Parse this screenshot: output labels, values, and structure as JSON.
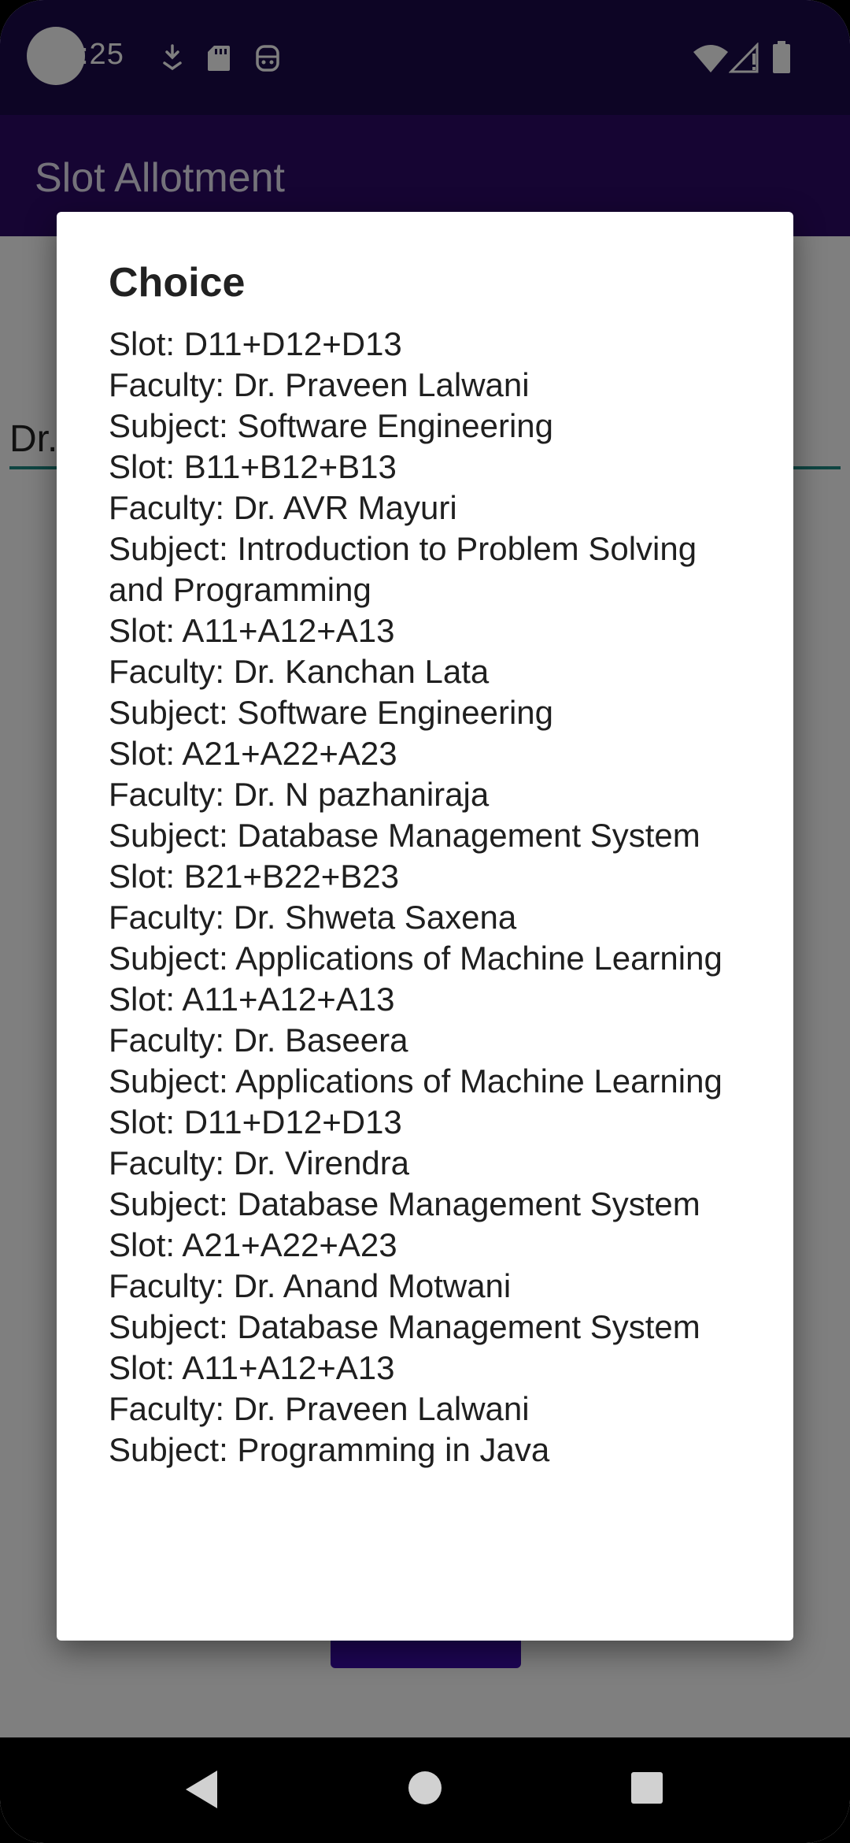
{
  "status_bar": {
    "time": ":25",
    "icons": [
      "download-icon",
      "sd-card-icon",
      "face-icon",
      "wifi-icon",
      "signal-icon",
      "battery-icon"
    ]
  },
  "app_bar": {
    "title": "Slot Allotment"
  },
  "background_form": {
    "field_text": "Dr."
  },
  "dialog": {
    "title": "Choice",
    "lines": [
      "Slot: D11+D12+D13",
      "Faculty: Dr. Praveen Lalwani",
      "Subject: Software Engineering",
      "Slot: B11+B12+B13",
      "Faculty: Dr. AVR Mayuri",
      "Subject: Introduction to Problem Solving and Programming",
      "Slot: A11+A12+A13",
      "Faculty: Dr. Kanchan Lata",
      "Subject: Software Engineering",
      "Slot: A21+A22+A23",
      "Faculty: Dr. N pazhaniraja",
      "Subject: Database Management System",
      "Slot: B21+B22+B23",
      "Faculty: Dr. Shweta Saxena",
      "Subject: Applications of Machine Learning",
      "Slot: A11+A12+A13",
      "Faculty: Dr. Baseera",
      "Subject: Applications of Machine Learning",
      "Slot: D11+D12+D13",
      "Faculty: Dr. Virendra",
      "Subject: Database Management System",
      "Slot: A21+A22+A23",
      "Faculty: Dr. Anand Motwani",
      "Subject: Database Management System",
      "Slot: A11+A12+A13",
      "Faculty: Dr. Praveen Lalwani",
      "Subject: Programming in Java"
    ]
  },
  "colors": {
    "status_bar": "#1b0a4a",
    "app_bar": "#2d0a66",
    "accent": "#1e8a84",
    "button": "#3b0aa8"
  }
}
